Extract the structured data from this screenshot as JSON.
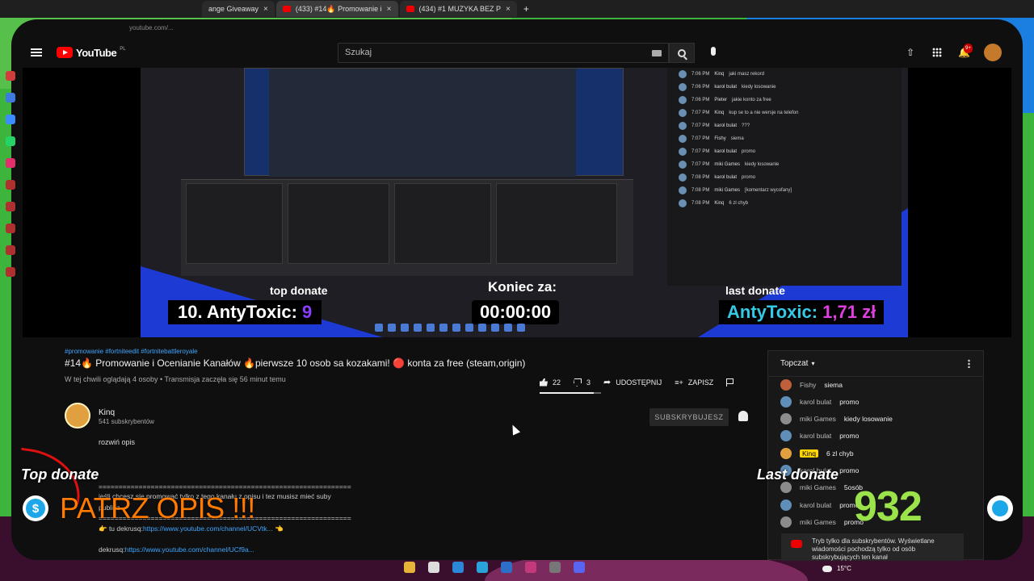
{
  "browser": {
    "tabs": [
      {
        "label": "ange Giveaway",
        "active": false
      },
      {
        "label": "(433) #14🔥 Promowanie i",
        "active": true
      },
      {
        "label": "(434) #1 MUZYKA BEZ P",
        "active": false
      }
    ],
    "url_hint": "youtube.com/..."
  },
  "header": {
    "logo_text": "YouTube",
    "logo_sup": "PL",
    "search_placeholder": "Szukaj",
    "notification_badge": "9+"
  },
  "player": {
    "overlay": {
      "top_donate_label": "top donate",
      "top_donor_rank": "10. AntyToxic:",
      "top_donor_value": "9",
      "countdown_label": "Koniec za:",
      "countdown_value": "00:00:00",
      "last_donate_label": "last donate",
      "last_donor_name": "AntyToxic:",
      "last_donor_value": "1,71 zł"
    },
    "embedded_chat": [
      {
        "time": "7:06 PM",
        "name": "Kinq",
        "msg": "jaki masz rekord"
      },
      {
        "time": "7:06 PM",
        "name": "karol bulat",
        "msg": "kiedy losowanie"
      },
      {
        "time": "7:06 PM",
        "name": "Pieter",
        "msg": "jakie konto za free"
      },
      {
        "time": "7:07 PM",
        "name": "Kinq",
        "msg": "kup se to a nie wersje na telefon"
      },
      {
        "time": "7:07 PM",
        "name": "karol bulat",
        "msg": "???"
      },
      {
        "time": "7:07 PM",
        "name": "Fishy",
        "msg": "siema"
      },
      {
        "time": "7:07 PM",
        "name": "karol bulat",
        "msg": "promo"
      },
      {
        "time": "7:07 PM",
        "name": "miki Games",
        "msg": "kiedy losowanie"
      },
      {
        "time": "7:08 PM",
        "name": "karol bulat",
        "msg": "promo"
      },
      {
        "time": "7:08 PM",
        "name": "miki Games",
        "msg": "[komentarz wycofany]"
      },
      {
        "time": "7:08 PM",
        "name": "Kinq",
        "msg": "6 zl chyb"
      }
    ]
  },
  "video": {
    "hashtags": "#promowanie #fortniteedit #fortnitebattleroyale",
    "title": "#14🔥 Promowanie i Ocenianie Kanałów 🔥pierwsze 10 osob sa kozakami! 🔴 konta za free (steam,origin)",
    "meta": "W tej chwili oglądają 4 osoby • Transmisja zaczęła się 56 minut temu",
    "likes": "22",
    "dislikes": "3",
    "like_ratio": 0.88,
    "share_label": "UDOSTĘPNIJ",
    "save_label": "ZAPISZ"
  },
  "channel": {
    "name": "Kinq",
    "subs": "541 subskrybentów",
    "subscribe_label": "SUBSKRYBUJESZ",
    "expand_label": "rozwiń opis"
  },
  "description": {
    "sep": "===============================================================",
    "line1": "jeśli chcesz się promować tylko z tego kanału z opisu i tez musisz mieć suby",
    "line2": "publicz",
    "line3_prefix": "👉 tu dekrusq:",
    "line3_link": "https://www.youtube.com/channel/UCVtk...",
    "line3_suffix": "👈",
    "line4_prefix": "dekrusq:",
    "line4_link": "https://www.youtube.com/channel/UCf9a..."
  },
  "live_chat": {
    "mode": "Topczat",
    "messages": [
      {
        "name": "Fishy",
        "msg": "siema",
        "owner": false,
        "color": "#c0603a"
      },
      {
        "name": "karol bulat",
        "msg": "promo",
        "owner": false,
        "color": "#5f8fb8"
      },
      {
        "name": "miki Games",
        "msg": "kiedy losowanie",
        "owner": false,
        "color": "#8c8c8c"
      },
      {
        "name": "karol bulat",
        "msg": "promo",
        "owner": false,
        "color": "#5f8fb8"
      },
      {
        "name": "Kinq",
        "msg": "6 zl chyb",
        "owner": true,
        "color": "#e0a040"
      },
      {
        "name": "karol bulat",
        "msg": "promo",
        "owner": false,
        "color": "#5f8fb8"
      },
      {
        "name": "miki Games",
        "msg": "5osób",
        "owner": false,
        "color": "#8c8c8c"
      },
      {
        "name": "karol bulat",
        "msg": "promo",
        "owner": false,
        "color": "#5f8fb8"
      },
      {
        "name": "miki Games",
        "msg": "promo",
        "owner": false,
        "color": "#8c8c8c"
      }
    ],
    "notice": "Tryb tylko dla subskrybentów. Wyświetlane wiadomości pochodzą tylko od osób subskrybujących ten kanał"
  },
  "stream_overlay": {
    "top_donate_label": "Top donate",
    "patrz_opis": "PATRZ OPIS !!!",
    "last_donate_label": "Last donate",
    "counter": "932",
    "dollar_sign": "$",
    "weather": "15°C"
  },
  "colors": {
    "yt_red": "#ff0000",
    "link_blue": "#3ea6ff",
    "overlay_orange": "#ff7a00",
    "counter_green": "#9be34a",
    "frame_green": "#3db53d",
    "frame_blue": "#1a7fe0"
  }
}
